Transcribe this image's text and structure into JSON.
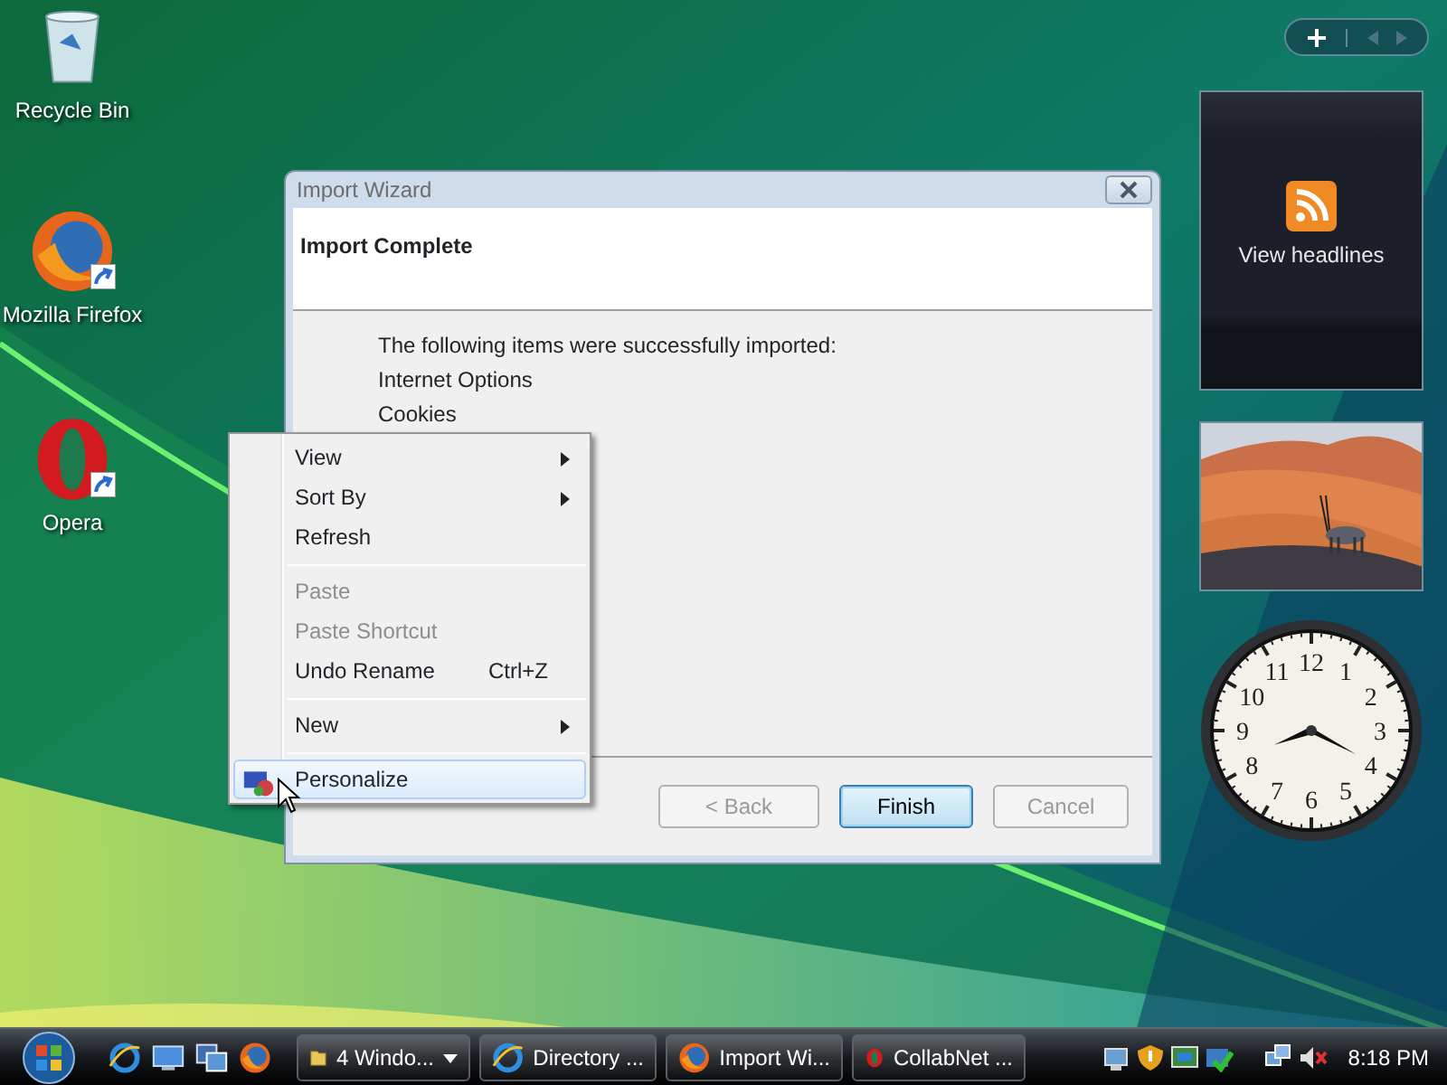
{
  "desktop_icons": [
    {
      "label": "Recycle Bin",
      "kind": "trash",
      "shortcut": false
    },
    {
      "label": "Mozilla Firefox",
      "kind": "firefox",
      "shortcut": true
    },
    {
      "label": "Opera",
      "kind": "opera",
      "shortcut": true
    }
  ],
  "wizard": {
    "title": "Import Wizard",
    "heading": "Import Complete",
    "message": "The following items were successfully imported:",
    "items": [
      "Internet Options",
      "Cookies"
    ],
    "buttons": [
      {
        "label": "< Back",
        "disabled": true,
        "default": false
      },
      {
        "label": "Finish",
        "disabled": false,
        "default": true
      },
      {
        "label": "Cancel",
        "disabled": true,
        "default": false
      }
    ]
  },
  "context_menu": {
    "items": [
      {
        "kind": "item",
        "label": "View",
        "submenu": true,
        "disabled": false,
        "selected": false
      },
      {
        "kind": "item",
        "label": "Sort By",
        "submenu": true,
        "disabled": false,
        "selected": false
      },
      {
        "kind": "item",
        "label": "Refresh",
        "submenu": false,
        "disabled": false,
        "selected": false
      },
      {
        "kind": "separator"
      },
      {
        "kind": "item",
        "label": "Paste",
        "submenu": false,
        "disabled": true,
        "selected": false
      },
      {
        "kind": "item",
        "label": "Paste Shortcut",
        "submenu": false,
        "disabled": true,
        "selected": false
      },
      {
        "kind": "item",
        "label": "Undo Rename",
        "shortcut_key": "Ctrl+Z",
        "submenu": false,
        "disabled": false,
        "selected": false
      },
      {
        "kind": "separator"
      },
      {
        "kind": "item",
        "label": "New",
        "submenu": true,
        "disabled": false,
        "selected": false
      },
      {
        "kind": "separator"
      },
      {
        "kind": "icon_item",
        "label": "Personalize",
        "submenu": false,
        "disabled": false,
        "selected": true
      }
    ]
  },
  "sidebar": {
    "feed": {
      "label": "View headlines"
    },
    "clock": {
      "numerals": [
        "11",
        "12",
        "1",
        "10",
        "2",
        "9",
        "3",
        "8",
        "4",
        "7",
        "5",
        "6"
      ]
    }
  },
  "taskbar": {
    "quick_launch": [
      {
        "kind": "ie"
      },
      {
        "kind": "desktop"
      },
      {
        "kind": "switch"
      },
      {
        "kind": "firefox"
      }
    ],
    "tasks": [
      {
        "label": "4 Windo...",
        "kind": "folder",
        "group": true
      },
      {
        "label": "Directory ...",
        "kind": "ie",
        "group": false
      },
      {
        "label": "Import Wi...",
        "kind": "firefox",
        "group": false
      },
      {
        "label": "CollabNet ...",
        "kind": "opera",
        "group": false
      }
    ],
    "tray_icons": [
      {
        "kind": "computer"
      },
      {
        "kind": "shield"
      },
      {
        "kind": "monitor"
      },
      {
        "kind": "check"
      },
      {
        "kind": "network"
      },
      {
        "kind": "volume-muted"
      }
    ],
    "time": "8:18 PM"
  }
}
